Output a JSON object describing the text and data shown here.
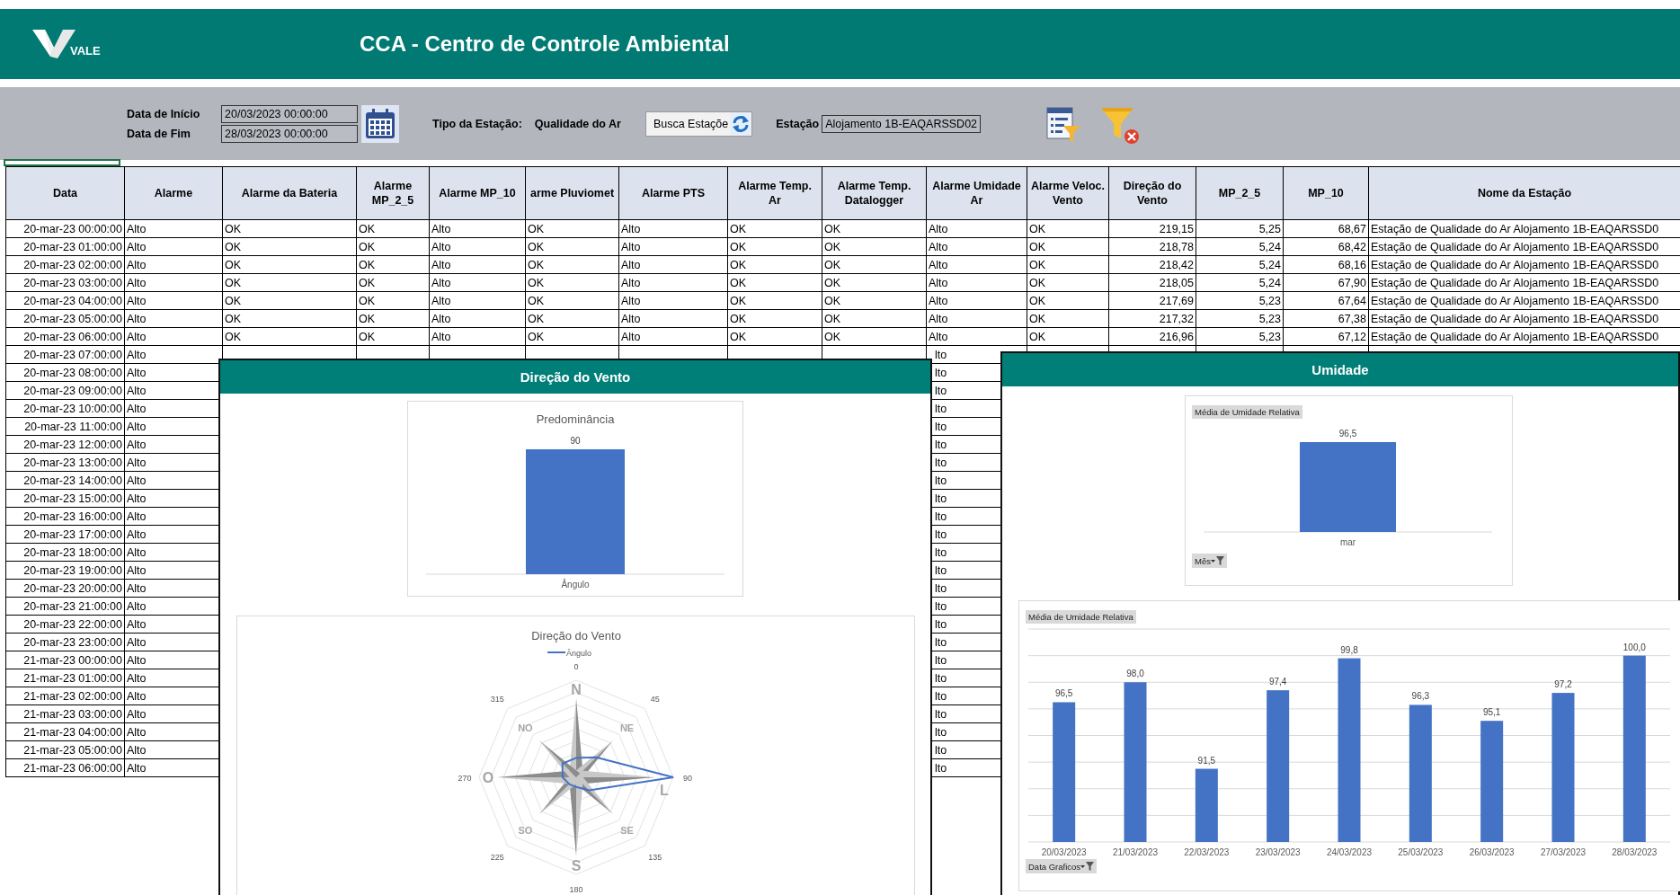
{
  "header": {
    "logo_text": "VALE",
    "title": "CCA - Centro de Controle Ambiental"
  },
  "filters": {
    "start_label": "Data de Início",
    "start_value": "20/03/2023 00:00:00",
    "end_label": "Data de Fim",
    "end_value": "28/03/2023 00:00:00",
    "type_label": "Tipo da Estação:",
    "type_value": "Qualidade do Ar",
    "search_button": "Busca Estaçõe",
    "station_label": "Estação",
    "station_value": "Alojamento 1B-EAQARSSD02"
  },
  "table": {
    "columns": [
      {
        "label": "Data",
        "kind": "number"
      },
      {
        "label": "Alarme",
        "kind": "text"
      },
      {
        "label": "Alarme da Bateria",
        "kind": "text"
      },
      {
        "label": "Alarme MP_2_5",
        "kind": "text"
      },
      {
        "label": "Alarme MP_10",
        "kind": "text"
      },
      {
        "label": "arme Pluviomet",
        "kind": "text"
      },
      {
        "label": "Alarme PTS",
        "kind": "text"
      },
      {
        "label": "Alarme Temp. Ar",
        "kind": "text"
      },
      {
        "label": "Alarme Temp. Datalogger",
        "kind": "text"
      },
      {
        "label": "Alarme Umidade Ar",
        "kind": "text"
      },
      {
        "label": "Alarme Veloc. Vento",
        "kind": "text"
      },
      {
        "label": "Direção do Vento",
        "kind": "number"
      },
      {
        "label": "MP_2_5",
        "kind": "number"
      },
      {
        "label": "MP_10",
        "kind": "number"
      },
      {
        "label": "Nome da Estação",
        "kind": "text"
      }
    ],
    "rows": [
      [
        "20-mar-23 00:00:00",
        "Alto",
        "OK",
        "OK",
        "Alto",
        "OK",
        "Alto",
        "OK",
        "OK",
        "Alto",
        "OK",
        "219,15",
        "5,25",
        "68,67",
        "Estação de Qualidade do Ar Alojamento 1B-EAQARSSD0"
      ],
      [
        "20-mar-23 01:00:00",
        "Alto",
        "OK",
        "OK",
        "Alto",
        "OK",
        "Alto",
        "OK",
        "OK",
        "Alto",
        "OK",
        "218,78",
        "5,24",
        "68,42",
        "Estação de Qualidade do Ar Alojamento 1B-EAQARSSD0"
      ],
      [
        "20-mar-23 02:00:00",
        "Alto",
        "OK",
        "OK",
        "Alto",
        "OK",
        "Alto",
        "OK",
        "OK",
        "Alto",
        "OK",
        "218,42",
        "5,24",
        "68,16",
        "Estação de Qualidade do Ar Alojamento 1B-EAQARSSD0"
      ],
      [
        "20-mar-23 03:00:00",
        "Alto",
        "OK",
        "OK",
        "Alto",
        "OK",
        "Alto",
        "OK",
        "OK",
        "Alto",
        "OK",
        "218,05",
        "5,24",
        "67,90",
        "Estação de Qualidade do Ar Alojamento 1B-EAQARSSD0"
      ],
      [
        "20-mar-23 04:00:00",
        "Alto",
        "OK",
        "OK",
        "Alto",
        "OK",
        "Alto",
        "OK",
        "OK",
        "Alto",
        "OK",
        "217,69",
        "5,23",
        "67,64",
        "Estação de Qualidade do Ar Alojamento 1B-EAQARSSD0"
      ],
      [
        "20-mar-23 05:00:00",
        "Alto",
        "OK",
        "OK",
        "Alto",
        "OK",
        "Alto",
        "OK",
        "OK",
        "Alto",
        "OK",
        "217,32",
        "5,23",
        "67,38",
        "Estação de Qualidade do Ar Alojamento 1B-EAQARSSD0"
      ],
      [
        "20-mar-23 06:00:00",
        "Alto",
        "OK",
        "OK",
        "Alto",
        "OK",
        "Alto",
        "OK",
        "OK",
        "Alto",
        "OK",
        "216,96",
        "5,23",
        "67,12",
        "Estação de Qualidade do Ar Alojamento 1B-EAQARSSD0"
      ]
    ],
    "partly_covered_rows": [
      {
        "data": "20-mar-23 07:00:00",
        "alarme": "Alto",
        "alarme_umidade_ar": "lto"
      },
      {
        "data": "20-mar-23 08:00:00",
        "alarme": "Alto",
        "alarme_umidade_ar": "lto"
      },
      {
        "data": "20-mar-23 09:00:00",
        "alarme": "Alto",
        "alarme_umidade_ar": "lto"
      },
      {
        "data": "20-mar-23 10:00:00",
        "alarme": "Alto",
        "alarme_umidade_ar": "lto"
      },
      {
        "data": "20-mar-23 11:00:00",
        "alarme": "Alto",
        "alarme_umidade_ar": "lto"
      },
      {
        "data": "20-mar-23 12:00:00",
        "alarme": "Alto",
        "alarme_umidade_ar": "lto"
      },
      {
        "data": "20-mar-23 13:00:00",
        "alarme": "Alto",
        "alarme_umidade_ar": "lto"
      },
      {
        "data": "20-mar-23 14:00:00",
        "alarme": "Alto",
        "alarme_umidade_ar": "lto"
      },
      {
        "data": "20-mar-23 15:00:00",
        "alarme": "Alto",
        "alarme_umidade_ar": "lto"
      },
      {
        "data": "20-mar-23 16:00:00",
        "alarme": "Alto",
        "alarme_umidade_ar": "lto"
      },
      {
        "data": "20-mar-23 17:00:00",
        "alarme": "Alto",
        "alarme_umidade_ar": "lto"
      },
      {
        "data": "20-mar-23 18:00:00",
        "alarme": "Alto",
        "alarme_umidade_ar": "lto"
      },
      {
        "data": "20-mar-23 19:00:00",
        "alarme": "Alto",
        "alarme_umidade_ar": "lto"
      },
      {
        "data": "20-mar-23 20:00:00",
        "alarme": "Alto",
        "alarme_umidade_ar": "lto"
      },
      {
        "data": "20-mar-23 21:00:00",
        "alarme": "Alto",
        "alarme_umidade_ar": "lto"
      },
      {
        "data": "20-mar-23 22:00:00",
        "alarme": "Alto",
        "alarme_umidade_ar": "lto"
      },
      {
        "data": "20-mar-23 23:00:00",
        "alarme": "Alto",
        "alarme_umidade_ar": "lto"
      },
      {
        "data": "21-mar-23 00:00:00",
        "alarme": "Alto",
        "alarme_umidade_ar": "lto"
      },
      {
        "data": "21-mar-23 01:00:00",
        "alarme": "Alto",
        "alarme_umidade_ar": "lto"
      },
      {
        "data": "21-mar-23 02:00:00",
        "alarme": "Alto",
        "alarme_umidade_ar": "lto"
      },
      {
        "data": "21-mar-23 03:00:00",
        "alarme": "Alto",
        "alarme_umidade_ar": "lto"
      },
      {
        "data": "21-mar-23 04:00:00",
        "alarme": "Alto",
        "alarme_umidade_ar": "lto"
      },
      {
        "data": "21-mar-23 05:00:00",
        "alarme": "Alto",
        "alarme_umidade_ar": "lto"
      },
      {
        "data": "21-mar-23 06:00:00",
        "alarme": "Alto",
        "alarme_umidade_ar": "lto"
      }
    ]
  },
  "wind_panel": {
    "title": "Direção do Vento",
    "predominance": {
      "title": "Predominância",
      "category": "Ângulo",
      "value_label": "90"
    },
    "radar": {
      "title": "Direção do Vento",
      "legend": "Ângulo",
      "angle_labels": [
        "0",
        "45",
        "90",
        "135",
        "180",
        "225",
        "270",
        "315"
      ],
      "compass_labels": [
        "N",
        "NE",
        "L",
        "SE",
        "S",
        "SO",
        "O",
        "NO"
      ]
    }
  },
  "humidity_panel": {
    "title": "Umidade",
    "monthly": {
      "tag": "Média de Umidade Relativa",
      "filter": "Mês",
      "category": "mar",
      "value_label": "96,5"
    },
    "daily": {
      "tag": "Média de Umidade Relativa",
      "filter": "Data Graficos",
      "chart_data": {
        "type": "bar",
        "categories": [
          "20/03/2023",
          "21/03/2023",
          "22/03/2023",
          "23/03/2023",
          "24/03/2023",
          "25/03/2023",
          "26/03/2023",
          "27/03/2023",
          "28/03/2023"
        ],
        "values": [
          96.5,
          98.0,
          91.5,
          97.4,
          99.8,
          96.3,
          95.1,
          97.2,
          100.0
        ],
        "value_labels": [
          "96,5",
          "98,0",
          "91,5",
          "97,4",
          "99,8",
          "96,3",
          "95,1",
          "97,2",
          "100,0"
        ],
        "data_labels": true,
        "ylim": [
          86,
          102
        ]
      }
    }
  }
}
